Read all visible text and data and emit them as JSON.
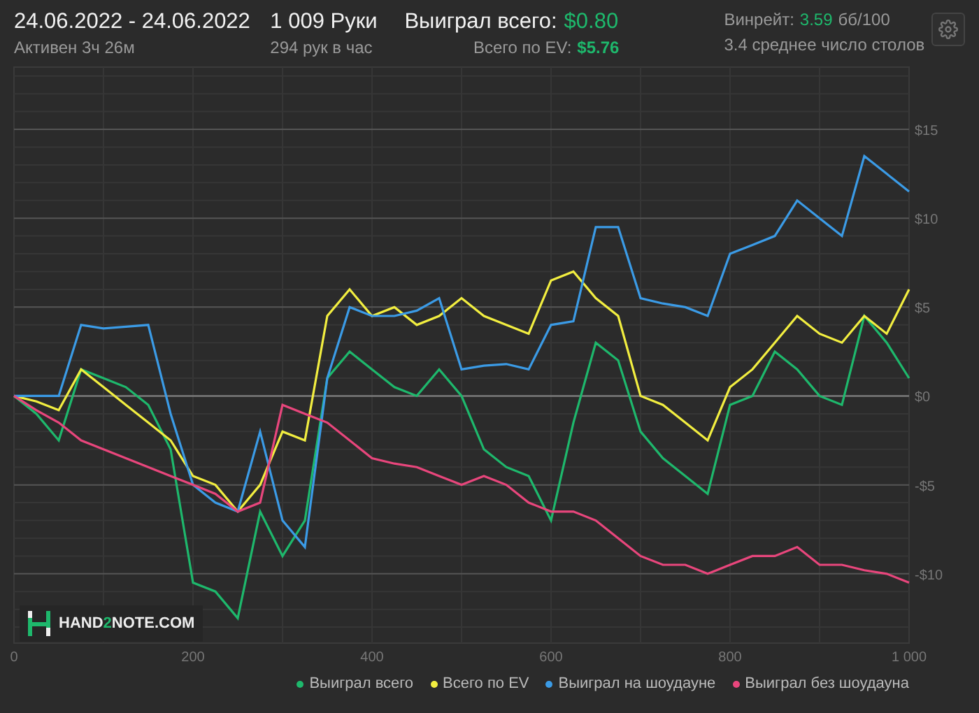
{
  "header": {
    "date_range": "24.06.2022 - 24.06.2022",
    "active_time": "Активен 3ч 26м",
    "hands": "1 009 Руки",
    "hands_per_hour": "294 рук в час",
    "won_total": {
      "label": "Выиграл всего:",
      "value": "$0.80"
    },
    "ev_total": {
      "label": "Всего по EV:",
      "value": "$5.76"
    },
    "winrate": {
      "label": "Винрейт:",
      "value": "3.59",
      "unit": "бб/100"
    },
    "tables": "3.4 среднее число столов"
  },
  "logo": {
    "parts": [
      "HAND",
      "2",
      "NOTE.COM"
    ]
  },
  "chart_data": {
    "type": "line",
    "x": [
      0,
      25,
      50,
      75,
      100,
      125,
      150,
      175,
      200,
      225,
      250,
      275,
      300,
      325,
      350,
      375,
      400,
      425,
      450,
      475,
      500,
      525,
      550,
      575,
      600,
      625,
      650,
      675,
      700,
      725,
      750,
      775,
      800,
      825,
      850,
      875,
      900,
      925,
      950,
      975,
      1000
    ],
    "grid": true,
    "xlim": [
      0,
      1000
    ],
    "ylim": [
      -13.9,
      18.5
    ],
    "xticks": [
      0,
      200,
      400,
      600,
      800,
      {
        "value": 1000,
        "label": "1 000"
      }
    ],
    "yticks": [
      {
        "value": 15,
        "label": "$15"
      },
      {
        "value": 10,
        "label": "$10"
      },
      {
        "value": 5,
        "label": "$5"
      },
      {
        "value": 0,
        "label": "$0"
      },
      {
        "value": -5,
        "label": "-$5"
      },
      {
        "value": -10,
        "label": "-$10"
      }
    ],
    "series": [
      {
        "name": "Выиграл всего",
        "color": "#1eb86c",
        "values": [
          0,
          -1,
          -2.5,
          1.5,
          1,
          0.5,
          -0.5,
          -3,
          -10.5,
          -11,
          -12.5,
          -6.5,
          -9,
          -7,
          1,
          2.5,
          1.5,
          0.5,
          0,
          1.5,
          0,
          -3,
          -4,
          -4.5,
          -7,
          -1.5,
          3,
          2,
          -2,
          -3.5,
          -4.5,
          -5.5,
          -0.5,
          0,
          2.5,
          1.5,
          0,
          -0.5,
          4.5,
          3,
          1
        ]
      },
      {
        "name": "Всего по EV",
        "color": "#f2ee40",
        "values": [
          0,
          -0.3,
          -0.8,
          1.5,
          0.5,
          -0.5,
          -1.5,
          -2.5,
          -4.5,
          -5,
          -6.5,
          -5,
          -2,
          -2.5,
          4.5,
          6,
          4.5,
          5,
          4,
          4.5,
          5.5,
          4.5,
          4,
          3.5,
          6.5,
          7,
          5.5,
          4.5,
          0,
          -0.5,
          -1.5,
          -2.5,
          0.5,
          1.5,
          3,
          4.5,
          3.5,
          3,
          4.5,
          3.5,
          6
        ]
      },
      {
        "name": "Выиграл на шоудауне",
        "color": "#3b9be6",
        "values": [
          0,
          0,
          0,
          4,
          3.8,
          3.9,
          4,
          -1,
          -5,
          -6,
          -6.5,
          -2,
          -7,
          -8.5,
          1,
          5,
          4.5,
          4.5,
          4.8,
          5.5,
          1.5,
          1.7,
          1.8,
          1.5,
          4,
          4.2,
          9.5,
          9.5,
          5.5,
          5.2,
          5,
          4.5,
          8,
          8.5,
          9,
          11,
          10,
          9,
          13.5,
          12.5,
          11.5
        ]
      },
      {
        "name": "Выиграл без шоудауна",
        "color": "#e8467c",
        "values": [
          0,
          -0.8,
          -1.5,
          -2.5,
          -3,
          -3.5,
          -4,
          -4.5,
          -5,
          -5.5,
          -6.5,
          -6,
          -0.5,
          -1,
          -1.5,
          -2.5,
          -3.5,
          -3.8,
          -4,
          -4.5,
          -5,
          -4.5,
          -5,
          -6,
          -6.5,
          -6.5,
          -7,
          -8,
          -9,
          -9.5,
          -9.5,
          -10,
          -9.5,
          -9,
          -9,
          -8.5,
          -9.5,
          -9.5,
          -9.8,
          -10,
          -10.5
        ]
      }
    ]
  }
}
